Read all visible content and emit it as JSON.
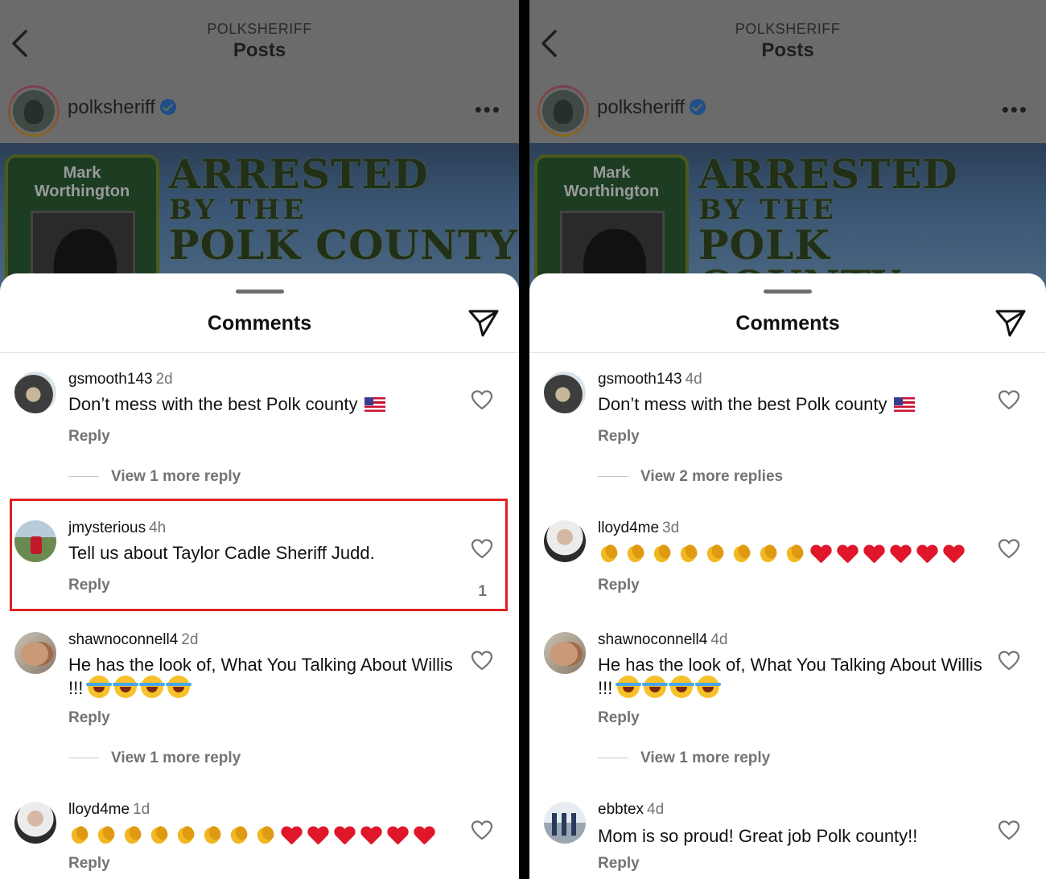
{
  "left": {
    "header": {
      "account": "POLKSHERIFF",
      "title": "Posts"
    },
    "post": {
      "username": "polksheriff",
      "image": {
        "name_line1": "Mark",
        "name_line2": "Worthington",
        "line1": "ARRESTED",
        "line2": "BY THE",
        "line3": "POLK COUNTY"
      }
    },
    "sheet_title": "Comments",
    "comments": [
      {
        "user": "gsmooth143",
        "time": "2d",
        "text": "Don’t mess with the best  Polk county",
        "reply": "Reply",
        "more": "View 1 more reply"
      },
      {
        "user": "jmysterious",
        "time": "4h",
        "text": "Tell us about Taylor Cadle Sheriff Judd.",
        "reply": "Reply",
        "likes": "1"
      },
      {
        "user": "shawnoconnell4",
        "time": "2d",
        "text": "He has the look of, What You Talking About Willis !!!",
        "reply": "Reply",
        "more": "View 1 more reply"
      },
      {
        "user": "lloyd4me",
        "time": "1d",
        "reply": "Reply"
      }
    ]
  },
  "right": {
    "header": {
      "account": "POLKSHERIFF",
      "title": "Posts"
    },
    "post": {
      "username": "polksheriff",
      "image": {
        "name_line1": "Mark",
        "name_line2": "Worthington",
        "line1": "ARRESTED",
        "line2": "BY THE",
        "line3": "POLK COUNTY"
      }
    },
    "sheet_title": "Comments",
    "comments": [
      {
        "user": "gsmooth143",
        "time": "4d",
        "text": "Don’t mess with the best  Polk county",
        "reply": "Reply",
        "more": "View 2 more replies"
      },
      {
        "user": "lloyd4me",
        "time": "3d",
        "reply": "Reply"
      },
      {
        "user": "shawnoconnell4",
        "time": "4d",
        "text": "He has the look of, What You Talking About Willis !!!",
        "reply": "Reply",
        "more": "View 1 more reply"
      },
      {
        "user": "ebbtex",
        "time": "4d",
        "text": "Mom is so proud! Great job Polk county!!",
        "reply": "Reply"
      }
    ]
  },
  "icons": {
    "back": "chevron-left-icon",
    "verified": "verified-badge-icon",
    "more": "more-horizontal-icon",
    "share": "paper-plane-icon",
    "like": "heart-outline-icon"
  },
  "colors": {
    "highlight": "#e02020",
    "muted_text": "#737373",
    "verified": "#1f4f86"
  }
}
